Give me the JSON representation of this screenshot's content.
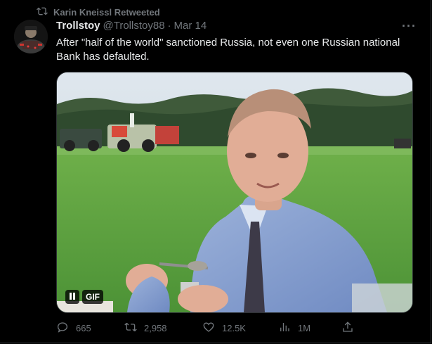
{
  "retweet_banner": {
    "text": "Karin Kneissl Retweeted",
    "icon": "retweet-icon"
  },
  "tweet": {
    "author_name": "Trollstoy",
    "handle": "@Trollstoy88",
    "separator": "·",
    "date": "Mar 14",
    "more": "···",
    "text": "After \"half of the world\" sanctioned Russia, not even one Russian national Bank has defaulted."
  },
  "media": {
    "type": "gif",
    "pause_label": "pause",
    "gif_label": "GIF"
  },
  "actions": {
    "reply_count": "665",
    "retweet_count": "2,958",
    "like_count": "12.5K",
    "view_count": "1M",
    "icons": [
      "reply-icon",
      "retweet-icon",
      "like-icon",
      "views-icon",
      "share-icon"
    ]
  },
  "colors": {
    "background": "#000000",
    "text_primary": "#e7e9ea",
    "text_secondary": "#71767b",
    "border": "#2f3336"
  }
}
